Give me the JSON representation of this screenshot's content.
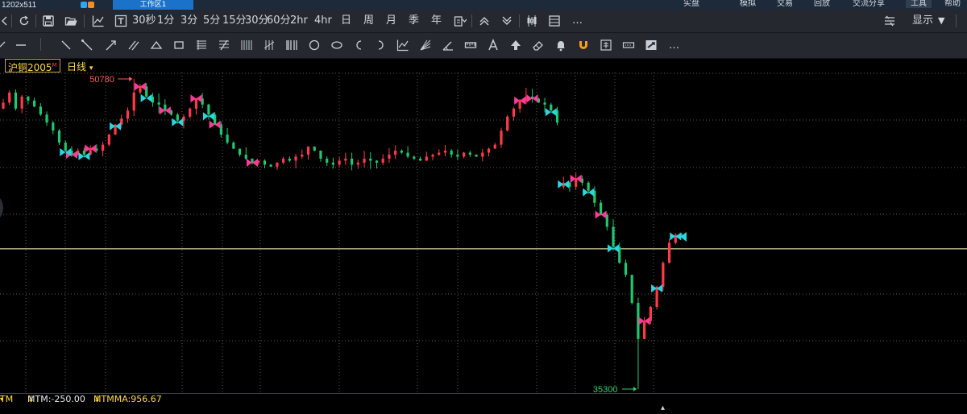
{
  "topbar": {
    "resolution": "1202x511",
    "workspace_tab": "工作区1",
    "menus": [
      "实盘",
      "模拟",
      "交易",
      "回放",
      "交流分享",
      "工具",
      "帮助"
    ],
    "active_menu": "工具"
  },
  "toolbar": {
    "periods": [
      "30秒",
      "1分",
      "3分",
      "5分",
      "15分",
      "30分",
      "60分",
      "2hr",
      "4hr",
      "日",
      "周",
      "月",
      "季",
      "年"
    ],
    "display_label": "显示",
    "display_arrow": "▼",
    "more_label": "…",
    "draw_more_label": "…"
  },
  "info": {
    "contract": "沪铜2005",
    "contract_sup": "M",
    "period": "日线",
    "period_arrow": "▾"
  },
  "chart_data": {
    "type": "candlestick",
    "high_label": "50780",
    "low_label": "35300",
    "high_value": 50780,
    "low_value": 35300,
    "reference_line_level": 42300,
    "colors": {
      "up": "#ff3b4a",
      "down": "#1fc76e",
      "grid": "#5a5a5a",
      "ref_line": "#d8d2a0",
      "signal_a": "#ff3b9a",
      "signal_b": "#2ad6e0",
      "label_high": "#ff5a5a",
      "label_low": "#2fcf6a"
    },
    "path_closes": [
      49600,
      50100,
      49300,
      49900,
      49700,
      49400,
      49000,
      48600,
      48200,
      47600,
      47200,
      47000,
      47200,
      47000,
      47300,
      47200,
      47500,
      48000,
      48500,
      48800,
      49200,
      50100,
      50400,
      49900,
      49600,
      49500,
      49200,
      49000,
      48700,
      48900,
      49300,
      49800,
      49500,
      49000,
      48500,
      48000,
      47600,
      47300,
      47000,
      46800,
      46600,
      46700,
      46500,
      46400,
      46600,
      46800,
      46700,
      46900,
      47000,
      47400,
      47200,
      46800,
      46600,
      46500,
      46700,
      46800,
      46500,
      46600,
      46800,
      46700,
      46600,
      46800,
      47000,
      47200,
      47100,
      46900,
      46800,
      46700,
      46900,
      47000,
      47100,
      47200,
      47000,
      46900,
      47100,
      47000,
      46900,
      47100,
      47300,
      47500,
      48200,
      48900,
      49300,
      49700,
      49900,
      49800,
      49600,
      49500,
      49200,
      48600,
      45600,
      45400,
      45800,
      45600,
      45200,
      44600,
      44000,
      43400,
      42400,
      41600,
      41000,
      39600,
      37800,
      38700,
      39400,
      40400,
      41600,
      42600,
      43000,
      42900
    ],
    "signals_a_idx": [
      11,
      14,
      22,
      26,
      31,
      34,
      40,
      83,
      85,
      92,
      96,
      103
    ],
    "signals_b_idx": [
      10,
      13,
      18,
      23,
      28,
      33,
      88,
      90,
      94,
      98,
      105,
      108
    ]
  },
  "bottom": {
    "prefix": "TM",
    "prefix_arrow": "▾",
    "mtm": "MTM:-250.00",
    "mtm_arrow": "↓",
    "mtmma": "MTMMA:956.67",
    "mtmma_arrow": "↓"
  }
}
